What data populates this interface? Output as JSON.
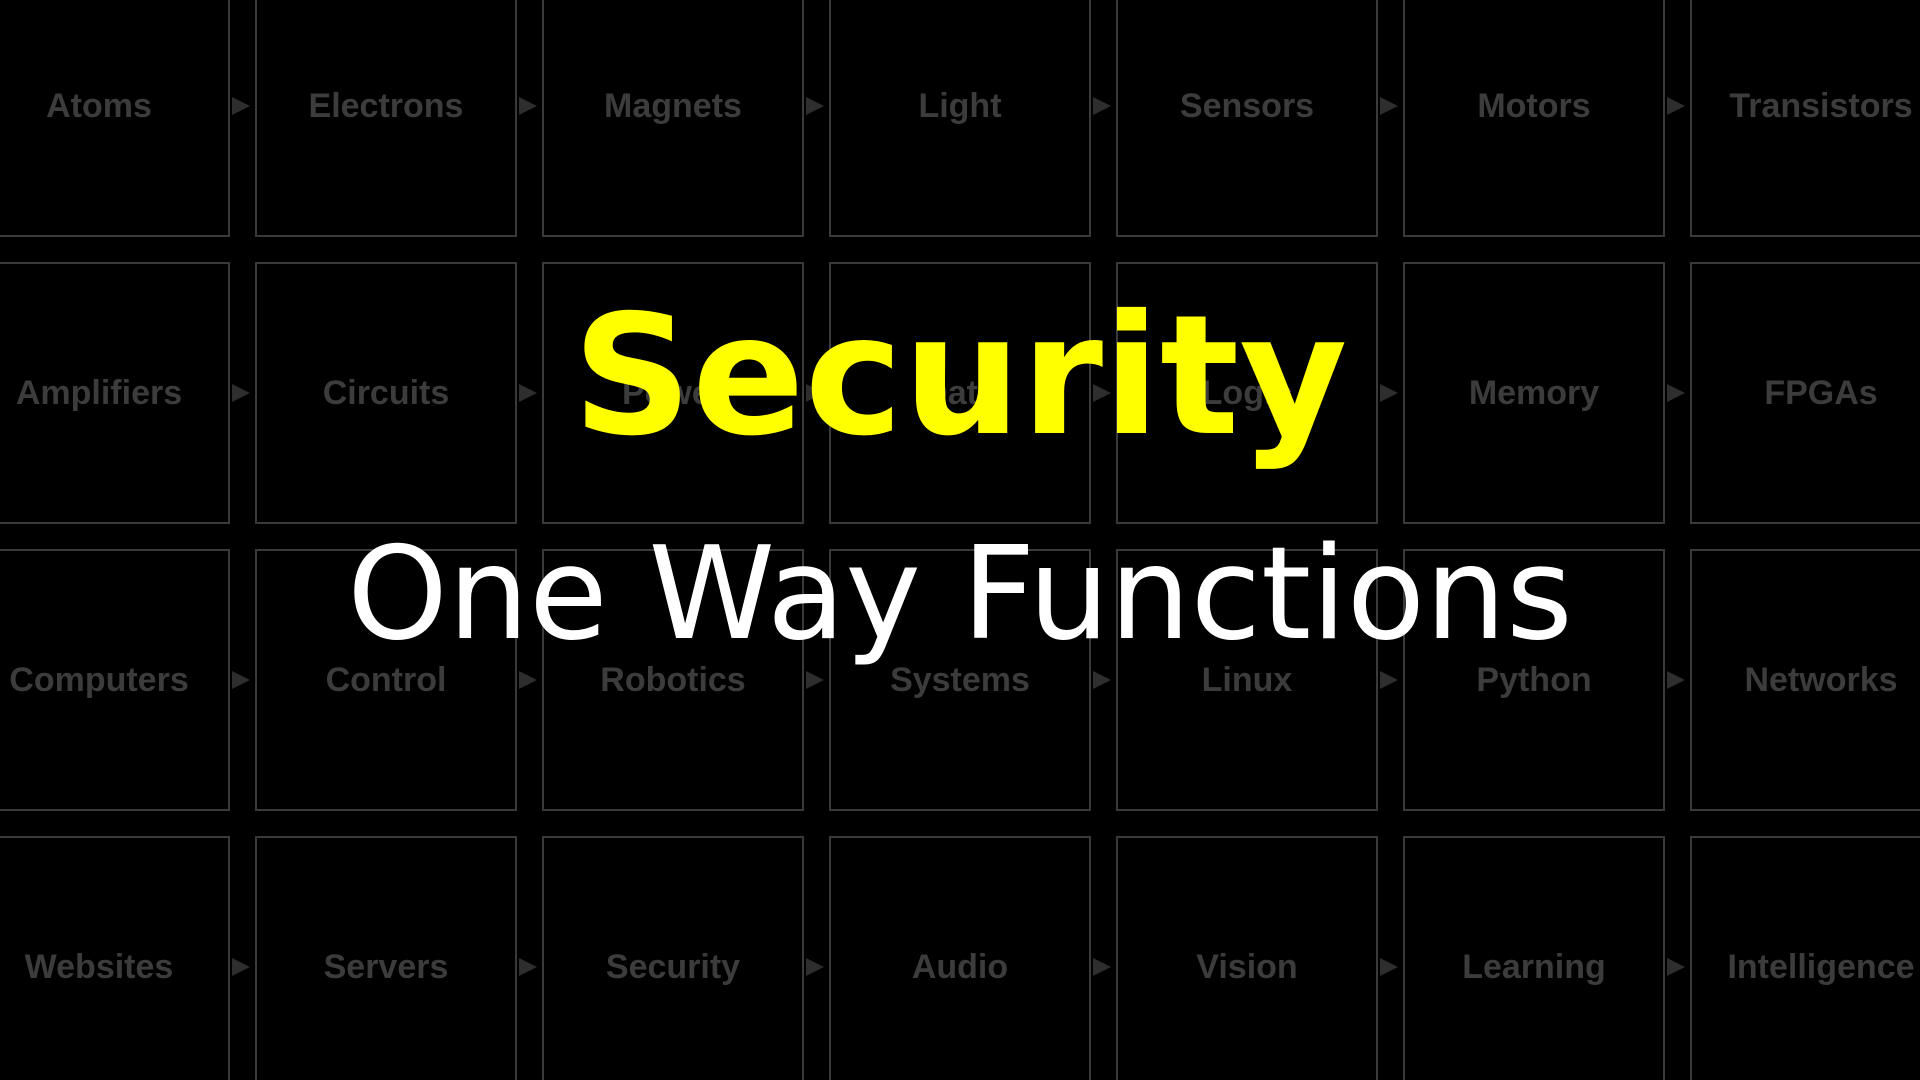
{
  "slide": {
    "title": "Security",
    "subtitle": "One Way Functions",
    "colors": {
      "background": "#000000",
      "title": "#ffff00",
      "subtitle": "#ffffff",
      "tile_border": "#3a3a3a",
      "tile_text": "#3c3c3c"
    }
  },
  "grid": {
    "rows": [
      [
        "Atoms",
        "Electrons",
        "Magnets",
        "Light",
        "Sensors",
        "Motors",
        "Transistors"
      ],
      [
        "Amplifiers",
        "Circuits",
        "Power",
        "Data",
        "Logic",
        "Memory",
        "FPGAs"
      ],
      [
        "Computers",
        "Control",
        "Robotics",
        "Systems",
        "Linux",
        "Python",
        "Networks"
      ],
      [
        "Websites",
        "Servers",
        "Security",
        "Audio",
        "Vision",
        "Learning",
        "Intelligence"
      ]
    ]
  }
}
